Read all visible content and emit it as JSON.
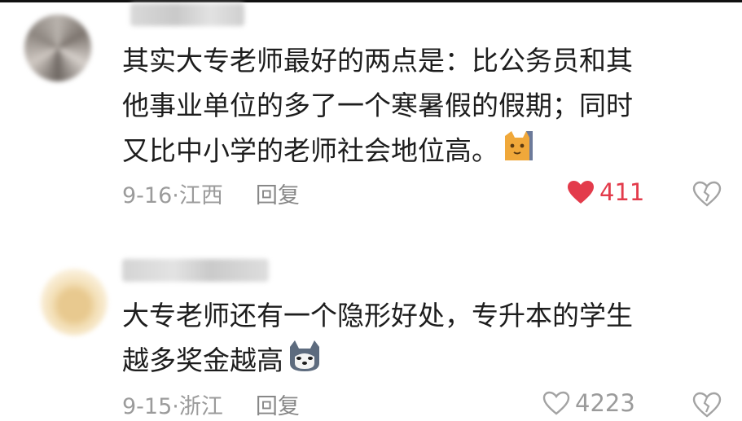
{
  "comments": [
    {
      "lines": [
        "其实大专老师最好的两点是：比公务员和其",
        "他事业单位的多了一个寒暑假的假期；同时",
        "又比中小学的老师社会地位高。"
      ],
      "emoji_icon": "cat-face-emoji",
      "date": "9-16·江西",
      "reply": "回复",
      "likes": "411",
      "liked": true
    },
    {
      "lines": [
        "大专老师还有一个隐形好处，专升本的学生",
        "越多奖金越高"
      ],
      "emoji_icon": "husky-face-emoji",
      "date": "9-15·浙江",
      "reply": "回复",
      "likes": "4223",
      "liked": false
    }
  ],
  "colors": {
    "like_active": "#e33b4b",
    "meta_text": "#9b9b9b",
    "body_text": "#1d1d1d"
  }
}
